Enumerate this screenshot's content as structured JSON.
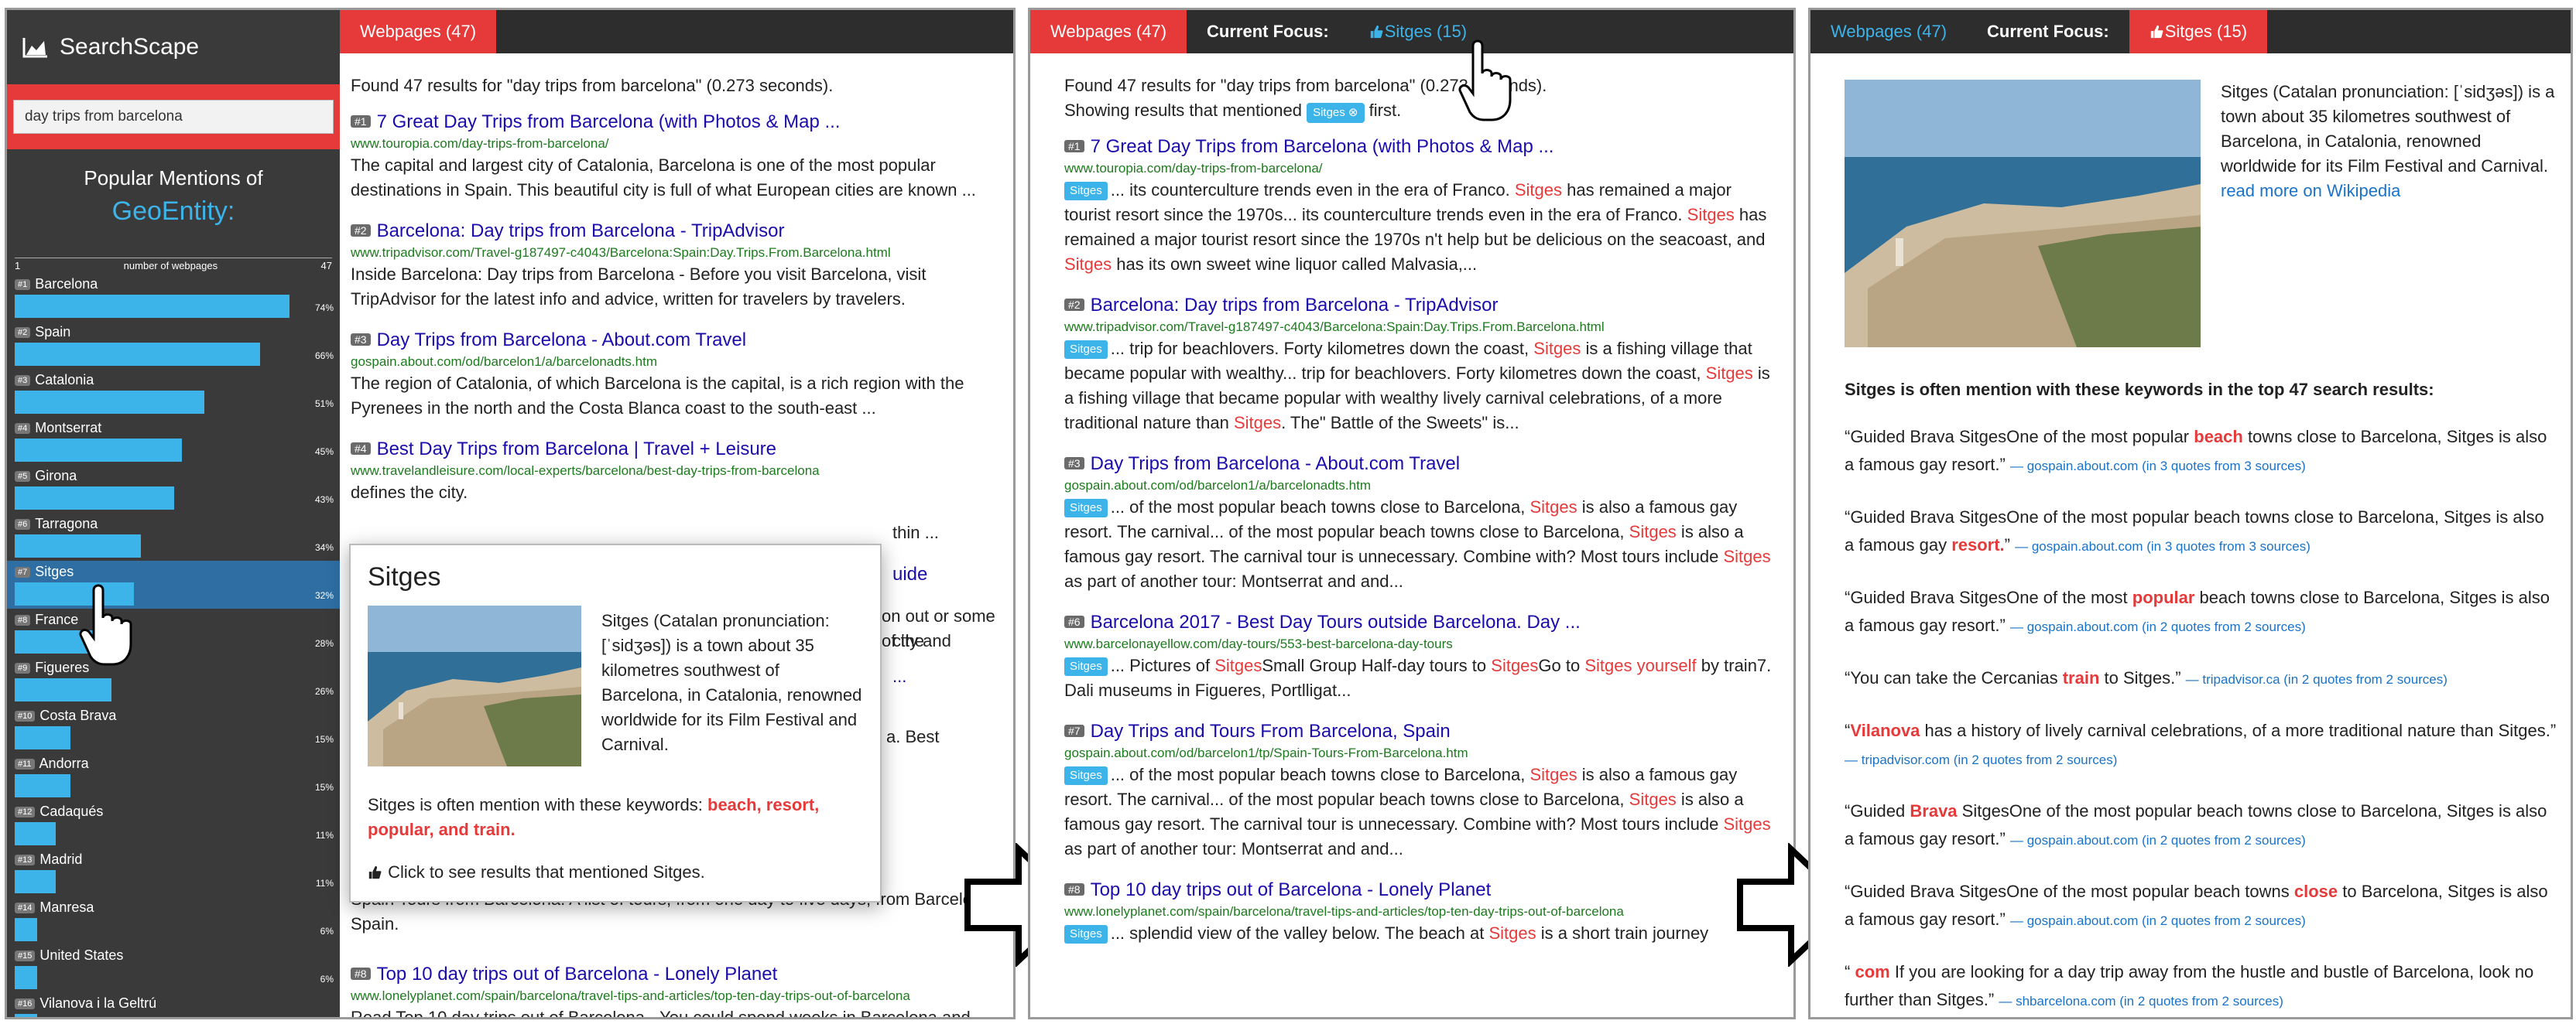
{
  "panel1": {
    "brand": "SearchScape",
    "search_value": "day trips from barcelona",
    "popular_title": "Popular Mentions of",
    "popular_entity": "GeoEntity:",
    "axis": {
      "min": "1",
      "label": "number of webpages",
      "max": "47"
    },
    "bars": [
      {
        "rank": "#1",
        "name": "Barcelona",
        "pct": 74,
        "pct_label": "74%"
      },
      {
        "rank": "#2",
        "name": "Spain",
        "pct": 66,
        "pct_label": "66%"
      },
      {
        "rank": "#3",
        "name": "Catalonia",
        "pct": 51,
        "pct_label": "51%"
      },
      {
        "rank": "#4",
        "name": "Montserrat",
        "pct": 45,
        "pct_label": "45%"
      },
      {
        "rank": "#5",
        "name": "Girona",
        "pct": 43,
        "pct_label": "43%"
      },
      {
        "rank": "#6",
        "name": "Tarragona",
        "pct": 34,
        "pct_label": "34%"
      },
      {
        "rank": "#7",
        "name": "Sitges",
        "pct": 32,
        "pct_label": "32%"
      },
      {
        "rank": "#8",
        "name": "France",
        "pct": 28,
        "pct_label": "28%"
      },
      {
        "rank": "#9",
        "name": "Figueres",
        "pct": 26,
        "pct_label": "26%"
      },
      {
        "rank": "#10",
        "name": "Costa Brava",
        "pct": 15,
        "pct_label": "15%"
      },
      {
        "rank": "#11",
        "name": "Andorra",
        "pct": 15,
        "pct_label": "15%"
      },
      {
        "rank": "#12",
        "name": "Cadaqués",
        "pct": 11,
        "pct_label": "11%"
      },
      {
        "rank": "#13",
        "name": "Madrid",
        "pct": 11,
        "pct_label": "11%"
      },
      {
        "rank": "#14",
        "name": "Manresa",
        "pct": 6,
        "pct_label": "6%"
      },
      {
        "rank": "#15",
        "name": "United States",
        "pct": 6,
        "pct_label": "6%"
      },
      {
        "rank": "#16",
        "name": "Vilanova i la Geltrú",
        "pct": 6,
        "pct_label": "6%"
      }
    ],
    "tab_webpages": "Webpages (47)",
    "found": "Found 47 results for \"day trips from barcelona\" (0.273 seconds).",
    "results": [
      {
        "num": "#1",
        "title": "7 Great Day Trips from Barcelona (with Photos & Map ...",
        "url": "www.touropia.com/day-trips-from-barcelona/",
        "snippet": "The capital and largest city of Catalonia, Barcelona is one of the most popular destinations in Spain. This beautiful city is full of what European cities are known ..."
      },
      {
        "num": "#2",
        "title": "Barcelona: Day trips from Barcelona - TripAdvisor",
        "url": "www.tripadvisor.com/Travel-g187497-c4043/Barcelona:Spain:Day.Trips.From.Barcelona.html",
        "snippet": "Inside Barcelona: Day trips from Barcelona - Before you visit Barcelona, visit TripAdvisor for the latest info and advice, written for travelers by travelers."
      },
      {
        "num": "#3",
        "title": "Day Trips from Barcelona - About.com Travel",
        "url": "gospain.about.com/od/barcelon1/a/barcelonadts.htm",
        "snippet": "The region of Catalonia, of which Barcelona is the capital, is a rich region with the Pyrenees in the north and the Costa Blanca coast to the south-east ..."
      },
      {
        "num": "#4",
        "title": "Best Day Trips from Barcelona | Travel + Leisure",
        "url": "www.travelandleisure.com/local-experts/barcelona/best-day-trips-from-barcelona",
        "snippet": "defines the city."
      }
    ],
    "behind_fragments": [
      "thin ...",
      "uide",
      "on out or some of the",
      "city and",
      "...",
      "a. Best",
      "Spain Tours from Barcelona. A list of tours, from one day to five days, from Barcelona,",
      "Spain."
    ],
    "result8": {
      "num": "#8",
      "title": "Top 10 day trips out of Barcelona - Lonely Planet",
      "url": "www.lonelyplanet.com/spain/barcelona/travel-tips-and-articles/top-ten-day-trips-out-of-barcelona",
      "snippet": "Read Top 10 day trips out of Barcelona - You could spend weeks in Barcelona and"
    },
    "popup": {
      "title": "Sitges",
      "desc": "Sitges (Catalan pronunciation: [ˈsidʒəs]) is a town about 35 kilometres southwest of Barcelona, in Catalonia, renowned worldwide for its Film Festival and Carnival.",
      "kw_intro": "Sitges is often mention with these keywords: ",
      "kw": "beach, resort, popular, and train.",
      "click": "Click to see results that mentioned Sitges."
    }
  },
  "panel2": {
    "tab_webpages": "Webpages (47)",
    "tab_focus": "Current Focus:",
    "tab_sitges": "Sitges (15)",
    "found": "Found 47 results for \"day trips from barcelona\" (0.273 seconds).",
    "showing_pre": "Showing results that mentioned ",
    "chip": "Sitges ⊗",
    "showing_post": " first.",
    "results": [
      {
        "num": "#1",
        "title": "7 Great Day Trips from Barcelona (with Photos & Map ...",
        "url": "www.touropia.com/day-trips-from-barcelona/",
        "snippet": "... its counterculture trends even in the era of Franco. Sitges has remained a major tourist resort since the 1970s... its counterculture trends even in the era of Franco. Sitges has remained a major tourist resort since the 1970s n't help but be delicious on the seacoast, and Sitges has its own sweet wine liquor called Malvasia,..."
      },
      {
        "num": "#2",
        "title": "Barcelona: Day trips from Barcelona - TripAdvisor",
        "url": "www.tripadvisor.com/Travel-g187497-c4043/Barcelona:Spain:Day.Trips.From.Barcelona.html",
        "snippet": "... trip for beachlovers. Forty kilometres down the coast, Sitges is a fishing village that became popular with wealthy... trip for beachlovers. Forty kilometres down the coast, Sitges is a fishing village that became popular with wealthy lively carnival celebrations, of a more traditional nature than Sitges. The\" Battle of the Sweets\" is..."
      },
      {
        "num": "#3",
        "title": "Day Trips from Barcelona - About.com Travel",
        "url": "gospain.about.com/od/barcelon1/a/barcelonadts.htm",
        "snippet": "... of the most popular beach towns close to Barcelona, Sitges is also a famous gay resort. The carnival... of the most popular beach towns close to Barcelona, Sitges is also a famous gay resort. The carnival tour is unnecessary. Combine with? Most tours include Sitges as part of another tour: Montserrat and and..."
      },
      {
        "num": "#6",
        "title": "Barcelona 2017 - Best Day Tours outside Barcelona. Day ...",
        "url": "www.barcelonayellow.com/day-tours/553-best-barcelona-day-tours",
        "snippet": "... Pictures of SitgesSmall Group Half-day tours to SitgesGo to Sitges yourself by train7. Dali museums in Figueres, Portlligat..."
      },
      {
        "num": "#7",
        "title": "Day Trips and Tours From Barcelona, Spain",
        "url": "gospain.about.com/od/barcelon1/tp/Spain-Tours-From-Barcelona.htm",
        "snippet": "... of the most popular beach towns close to Barcelona, Sitges is also a famous gay resort. The carnival... of the most popular beach towns close to Barcelona, Sitges is also a famous gay resort. The carnival tour is unnecessary. Combine with? Most tours include Sitges as part of another tour: Montserrat and and..."
      },
      {
        "num": "#8",
        "title": "Top 10 day trips out of Barcelona - Lonely Planet",
        "url": "www.lonelyplanet.com/spain/barcelona/travel-tips-and-articles/top-ten-day-trips-out-of-barcelona",
        "snippet": "... splendid view of the valley below. The beach at Sitges is a short train journey"
      }
    ],
    "tag": "Sitges"
  },
  "panel3": {
    "tab_webpages": "Webpages (47)",
    "tab_focus": "Current Focus:",
    "tab_sitges": "Sitges (15)",
    "desc": "Sitges (Catalan pronunciation: [ˈsidʒəs]) is a town about 35 kilometres southwest of Barcelona, in Catalonia, renowned worldwide for its Film Festival and Carnival. ",
    "wiki_link": "read more on Wikipedia",
    "heading": "Sitges is often mention with these keywords in the top 47 search results:",
    "quotes": [
      {
        "pre": "“Guided Brava SitgesOne of the most popular ",
        "kw": "beach",
        "post": " towns close to Barcelona, Sitges is also a famous gay resort.”",
        "src": "— gospain.about.com (in 3 quotes from 3 sources)"
      },
      {
        "pre": "“Guided Brava SitgesOne of the most popular beach towns close to Barcelona, Sitges is also a famous gay ",
        "kw": "resort.",
        "post": "”",
        "src": "— gospain.about.com (in 3 quotes from 3 sources)"
      },
      {
        "pre": "“Guided Brava SitgesOne of the most ",
        "kw": "popular",
        "post": " beach towns close to Barcelona, Sitges is also a famous gay resort.”",
        "src": "— gospain.about.com (in 2 quotes from 2 sources)"
      },
      {
        "pre": "“You can take the Cercanias ",
        "kw": "train",
        "post": " to Sitges.”",
        "src": "— tripadvisor.ca (in 2 quotes from 2 sources)"
      },
      {
        "pre": "“",
        "kw": "Vilanova",
        "post": " has a history of lively carnival celebrations, of a more traditional nature than Sitges.”",
        "src": "— tripadvisor.com (in 2 quotes from 2 sources)"
      },
      {
        "pre": "“Guided ",
        "kw": "Brava",
        "post": " SitgesOne of the most popular beach towns close to Barcelona, Sitges is also a famous gay resort.”",
        "src": "— gospain.about.com (in 2 quotes from 2 sources)"
      },
      {
        "pre": "“Guided Brava SitgesOne of the most popular beach towns ",
        "kw": "close",
        "post": " to Barcelona, Sitges is also a famous gay resort.”",
        "src": "— gospain.about.com (in 2 quotes from 2 sources)"
      },
      {
        "pre": "“ ",
        "kw": "com",
        "post": " If you are looking for a day trip away from the hustle and bustle of Barcelona, look no further than Sitges.”",
        "src": "— shbarcelona.com (in 2 quotes from 2 sources)"
      }
    ]
  },
  "colors": {
    "accent_red": "#e63a3a",
    "accent_blue": "#3cb4ea",
    "sidebar_bg": "#3a3a3a",
    "tabbar_bg": "#2d2d2d"
  },
  "icons": [
    "chart-logo-icon",
    "thumbs-up-icon",
    "hand-cursor-icon",
    "right-arrow-icon"
  ]
}
